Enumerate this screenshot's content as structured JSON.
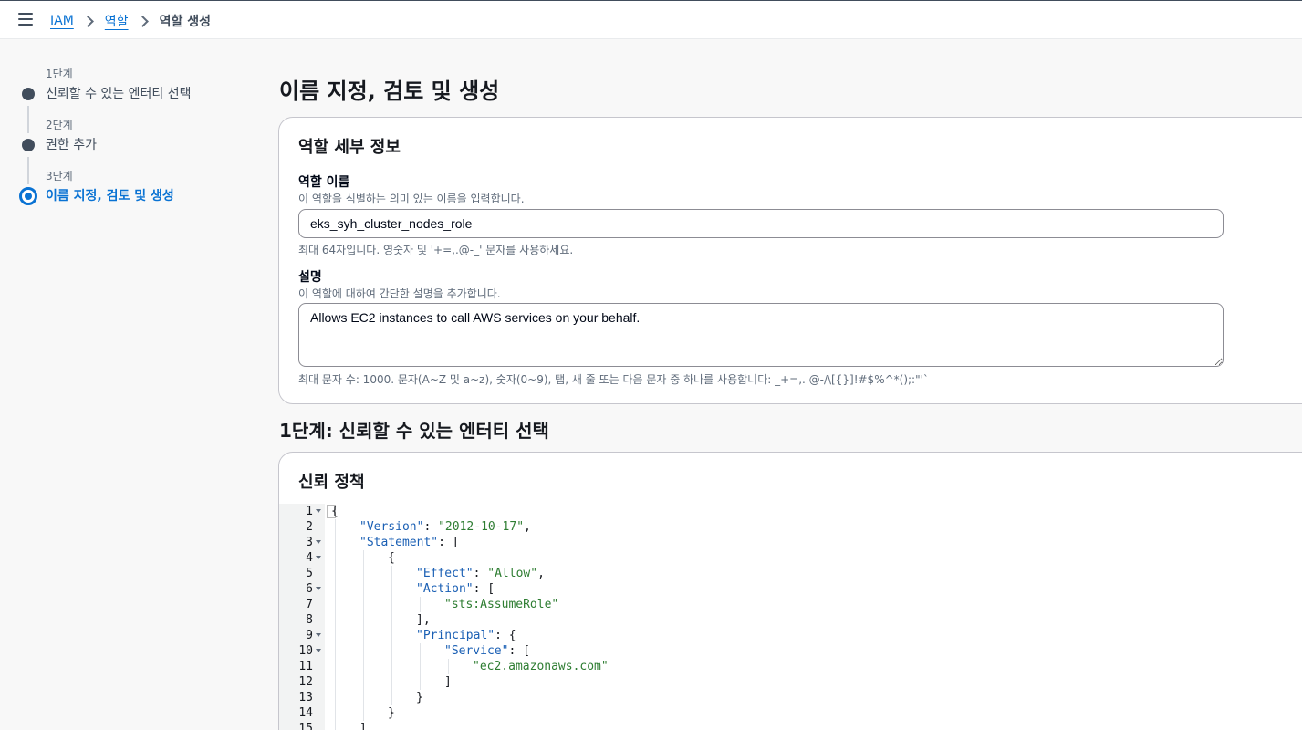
{
  "breadcrumb": {
    "items": [
      "IAM",
      "역할"
    ],
    "current": "역할 생성"
  },
  "wizard": {
    "steps": [
      {
        "number": "1단계",
        "title": "신뢰할 수 있는 엔터티 선택",
        "state": "completed"
      },
      {
        "number": "2단계",
        "title": "권한 추가",
        "state": "completed"
      },
      {
        "number": "3단계",
        "title": "이름 지정, 검토 및 생성",
        "state": "current"
      }
    ]
  },
  "main": {
    "title": "이름 지정, 검토 및 생성",
    "role_details": {
      "heading": "역할 세부 정보",
      "name_label": "역할 이름",
      "name_description": "이 역할을 식별하는 의미 있는 이름을 입력합니다.",
      "name_value": "eks_syh_cluster_nodes_role",
      "name_hint": "최대 64자입니다. 영숫자 및 '+=,.@-_' 문자를 사용하세요.",
      "desc_label": "설명",
      "desc_description": "이 역할에 대하여 간단한 설명을 추가합니다.",
      "desc_value": "Allows EC2 instances to call AWS services on your behalf.",
      "desc_hint": "최대 문자 수: 1000. 문자(A~Z 및 a~z), 숫자(0~9), 탭, 새 줄 또는 다음 문자 중 하나를 사용합니다: _+=,. @-/\\[{}]!#$%^*();:\"'`"
    },
    "step1_heading": "1단계: 신뢰할 수 있는 엔터티 선택",
    "trust_policy": {
      "heading": "신뢰 정책",
      "lines": [
        {
          "n": "1",
          "fold": true,
          "indent": 0,
          "tokens": [
            [
              "p",
              "{"
            ]
          ]
        },
        {
          "n": "2",
          "fold": false,
          "indent": 1,
          "tokens": [
            [
              "k",
              "\"Version\""
            ],
            [
              "p",
              ": "
            ],
            [
              "s",
              "\"2012-10-17\""
            ],
            [
              "p",
              ","
            ]
          ]
        },
        {
          "n": "3",
          "fold": true,
          "indent": 1,
          "tokens": [
            [
              "k",
              "\"Statement\""
            ],
            [
              "p",
              ": ["
            ]
          ]
        },
        {
          "n": "4",
          "fold": true,
          "indent": 2,
          "tokens": [
            [
              "p",
              "{"
            ]
          ]
        },
        {
          "n": "5",
          "fold": false,
          "indent": 3,
          "tokens": [
            [
              "k",
              "\"Effect\""
            ],
            [
              "p",
              ": "
            ],
            [
              "s",
              "\"Allow\""
            ],
            [
              "p",
              ","
            ]
          ]
        },
        {
          "n": "6",
          "fold": true,
          "indent": 3,
          "tokens": [
            [
              "k",
              "\"Action\""
            ],
            [
              "p",
              ": ["
            ]
          ]
        },
        {
          "n": "7",
          "fold": false,
          "indent": 4,
          "tokens": [
            [
              "s",
              "\"sts:AssumeRole\""
            ]
          ]
        },
        {
          "n": "8",
          "fold": false,
          "indent": 3,
          "tokens": [
            [
              "p",
              "],"
            ]
          ]
        },
        {
          "n": "9",
          "fold": true,
          "indent": 3,
          "tokens": [
            [
              "k",
              "\"Principal\""
            ],
            [
              "p",
              ": {"
            ]
          ]
        },
        {
          "n": "10",
          "fold": true,
          "indent": 4,
          "tokens": [
            [
              "k",
              "\"Service\""
            ],
            [
              "p",
              ": ["
            ]
          ]
        },
        {
          "n": "11",
          "fold": false,
          "indent": 5,
          "tokens": [
            [
              "s",
              "\"ec2.amazonaws.com\""
            ]
          ]
        },
        {
          "n": "12",
          "fold": false,
          "indent": 4,
          "tokens": [
            [
              "p",
              "]"
            ]
          ]
        },
        {
          "n": "13",
          "fold": false,
          "indent": 3,
          "tokens": [
            [
              "p",
              "}"
            ]
          ]
        },
        {
          "n": "14",
          "fold": false,
          "indent": 2,
          "tokens": [
            [
              "p",
              "}"
            ]
          ]
        },
        {
          "n": "15",
          "fold": false,
          "indent": 1,
          "tokens": [
            [
              "p",
              "]"
            ]
          ]
        }
      ]
    }
  },
  "colors": {
    "link": "#0972d3",
    "json_key": "#1a5fb4",
    "json_string": "#2e7d32",
    "step_active": "#0972d3"
  }
}
